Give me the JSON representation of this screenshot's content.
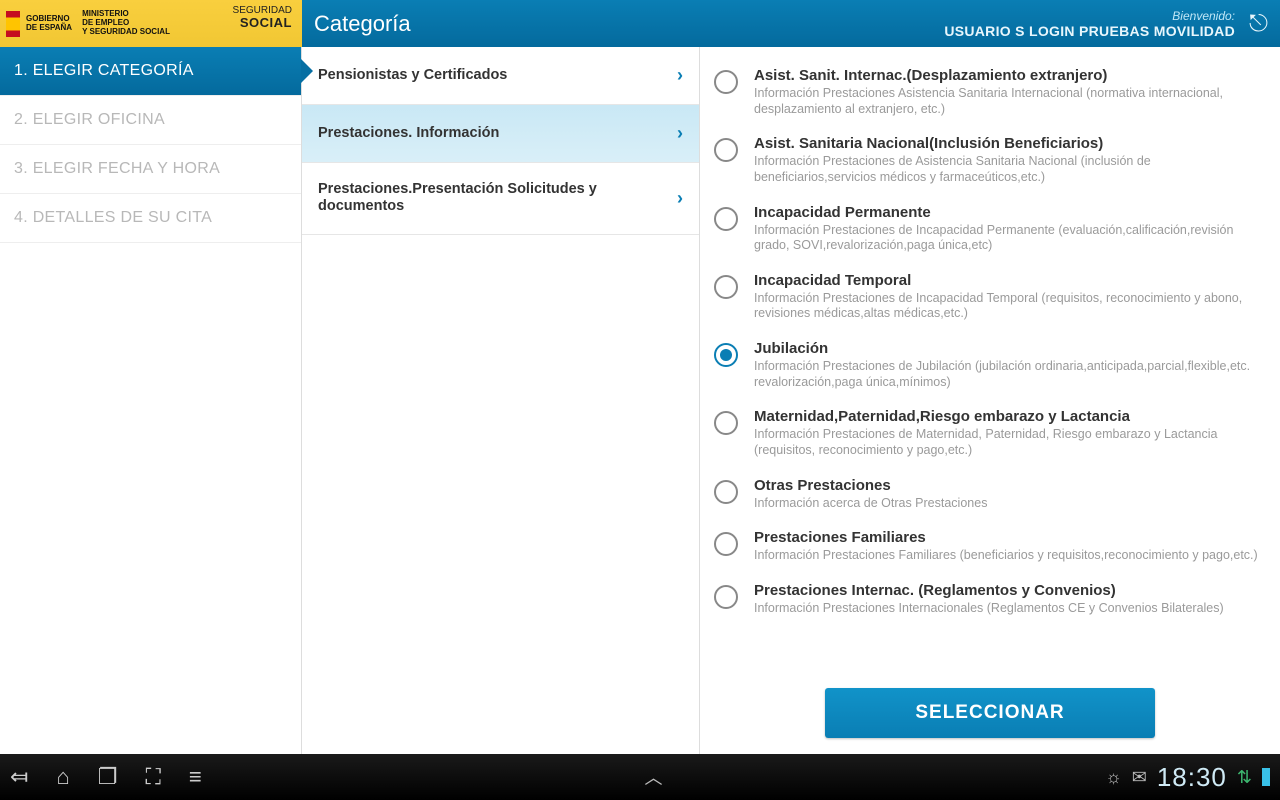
{
  "header": {
    "title": "Categoría",
    "welcome": "Bienvenido:",
    "user": "USUARIO S LOGIN PRUEBAS MOVILIDAD"
  },
  "gov": {
    "gobierno1": "GOBIERNO",
    "gobierno2": "DE ESPAÑA",
    "ministerio1": "MINISTERIO",
    "ministerio2": "DE EMPLEO",
    "ministerio3": "Y SEGURIDAD SOCIAL",
    "seguridad": "SEGURIDAD",
    "social": "SOCIAL"
  },
  "steps": [
    {
      "label": "1. ELEGIR CATEGORÍA",
      "active": true
    },
    {
      "label": "2. ELEGIR OFICINA",
      "active": false
    },
    {
      "label": "3. ELEGIR FECHA Y HORA",
      "active": false
    },
    {
      "label": "4. DETALLES DE SU CITA",
      "active": false
    }
  ],
  "categories": [
    {
      "label": "Pensionistas y Certificados",
      "selected": false
    },
    {
      "label": "Prestaciones. Información",
      "selected": true
    },
    {
      "label": "Prestaciones.Presentación Solicitudes y documentos",
      "selected": false
    }
  ],
  "options": [
    {
      "title": "Asist. Sanit. Internac.(Desplazamiento extranjero)",
      "desc": "Información Prestaciones Asistencia Sanitaria Internacional (normativa internacional, desplazamiento al extranjero, etc.)",
      "checked": false
    },
    {
      "title": "Asist. Sanitaria Nacional(Inclusión Beneficiarios)",
      "desc": "Información Prestaciones de Asistencia Sanitaria Nacional (inclusión de beneficiarios,servicios médicos y farmaceúticos,etc.)",
      "checked": false
    },
    {
      "title": "Incapacidad Permanente",
      "desc": "Información Prestaciones de Incapacidad Permanente (evaluación,calificación,revisión grado, SOVI,revalorización,paga única,etc)",
      "checked": false
    },
    {
      "title": "Incapacidad Temporal",
      "desc": "Información Prestaciones de Incapacidad Temporal (requisitos, reconocimiento y abono, revisiones médicas,altas médicas,etc.)",
      "checked": false
    },
    {
      "title": "Jubilación",
      "desc": "Información Prestaciones de Jubilación (jubilación ordinaria,anticipada,parcial,flexible,etc. revalorización,paga única,mínimos)",
      "checked": true
    },
    {
      "title": "Maternidad,Paternidad,Riesgo embarazo y Lactancia",
      "desc": "Información Prestaciones de Maternidad, Paternidad, Riesgo embarazo y Lactancia (requisitos, reconocimiento y pago,etc.)",
      "checked": false
    },
    {
      "title": "Otras Prestaciones",
      "desc": "Información acerca de Otras Prestaciones",
      "checked": false
    },
    {
      "title": "Prestaciones Familiares",
      "desc": "Información Prestaciones Familiares (beneficiarios y requisitos,reconocimiento y pago,etc.)",
      "checked": false
    },
    {
      "title": "Prestaciones Internac. (Reglamentos y Convenios)",
      "desc": "Información Prestaciones Internacionales (Reglamentos CE y Convenios Bilaterales)",
      "checked": false
    }
  ],
  "select_label": "SELECCIONAR",
  "statusbar": {
    "time": "18:30"
  }
}
